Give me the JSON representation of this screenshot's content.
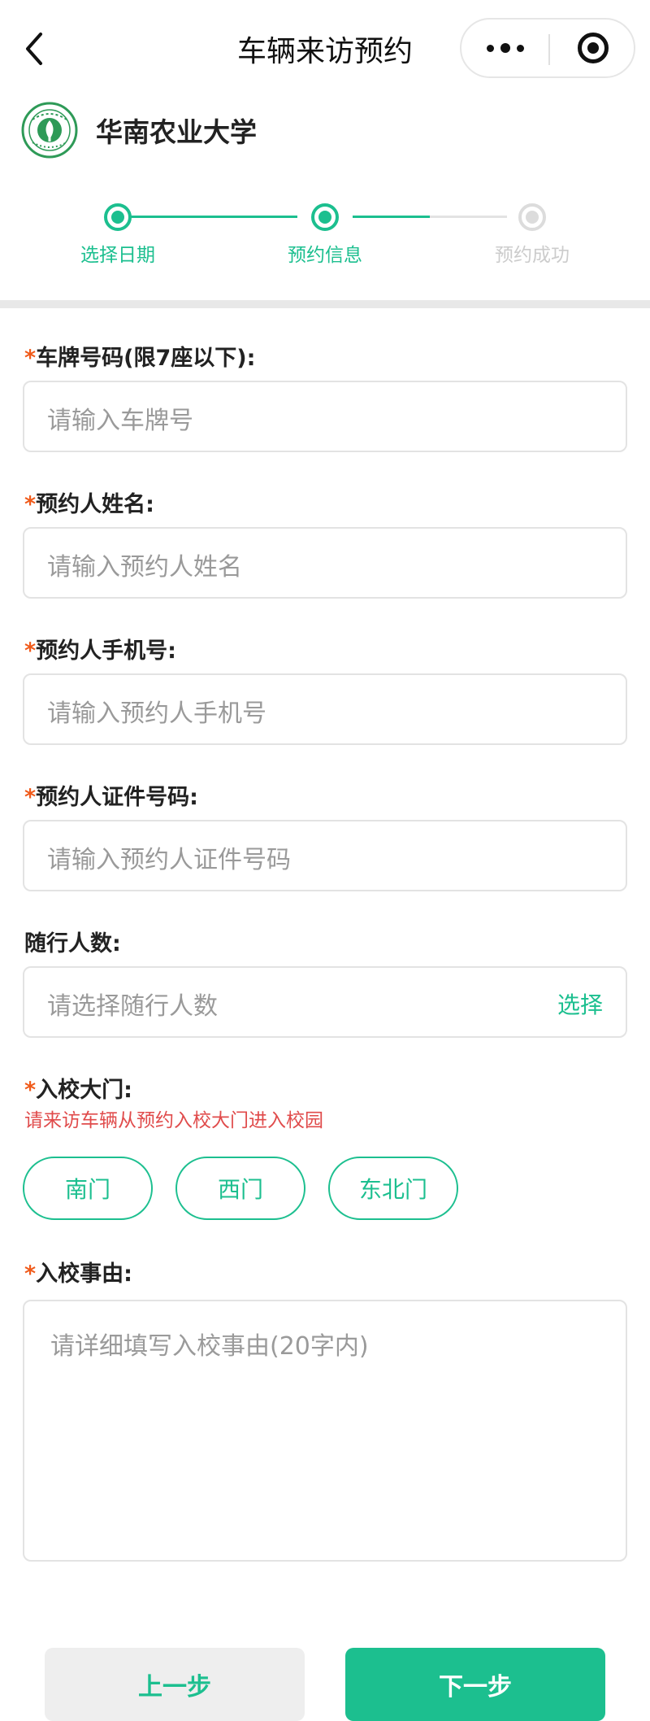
{
  "nav": {
    "title": "车辆来访预约"
  },
  "brand": {
    "name": "华南农业大学",
    "accent": "#1cbf8f"
  },
  "steps": [
    {
      "label": "选择日期",
      "state": "done"
    },
    {
      "label": "预约信息",
      "state": "active"
    },
    {
      "label": "预约成功",
      "state": "pending"
    }
  ],
  "form": {
    "plate": {
      "required": "*",
      "label": "车牌号码(限7座以下):",
      "placeholder": "请输入车牌号"
    },
    "name": {
      "required": "*",
      "label": "预约人姓名:",
      "placeholder": "请输入预约人姓名"
    },
    "phone": {
      "required": "*",
      "label": "预约人手机号:",
      "placeholder": "请输入预约人手机号"
    },
    "idno": {
      "required": "*",
      "label": "预约人证件号码:",
      "placeholder": "请输入预约人证件号码"
    },
    "companions": {
      "label": "随行人数:",
      "placeholder": "请选择随行人数",
      "select_label": "选择"
    },
    "gate": {
      "required": "*",
      "label": "入校大门:",
      "hint": "请来访车辆从预约入校大门进入校园",
      "options": [
        "南门",
        "西门",
        "东北门"
      ]
    },
    "reason": {
      "required": "*",
      "label": "入校事由:",
      "placeholder": "请详细填写入校事由(20字内)"
    }
  },
  "buttons": {
    "prev": "上一步",
    "next": "下一步"
  },
  "icons": {
    "back": "chevron-left-icon",
    "more": "more-dots-icon",
    "close": "target-circle-icon",
    "logo": "university-emblem-icon"
  }
}
